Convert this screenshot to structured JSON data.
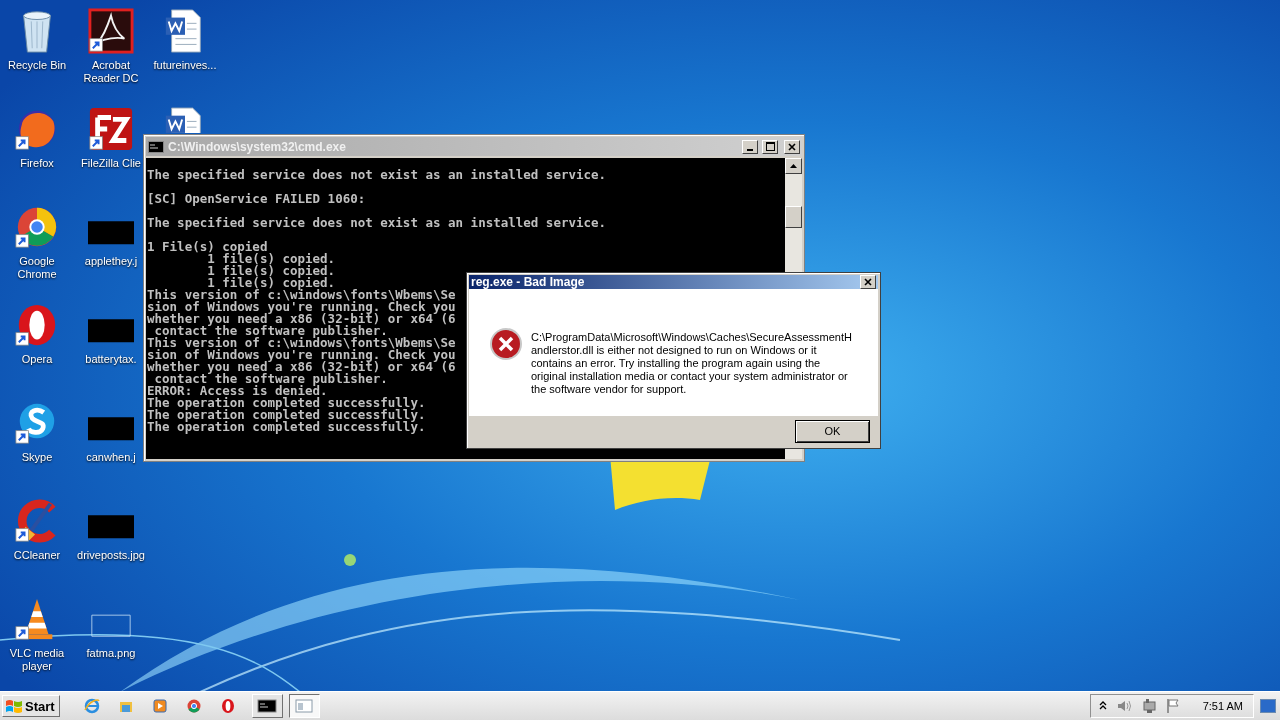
{
  "desktop": {
    "icons": [
      {
        "label": "Recycle Bin",
        "kind": "bin",
        "shortcut": false
      },
      {
        "label": "Firefox",
        "kind": "app",
        "shortcut": true
      },
      {
        "label": "Google Chrome",
        "kind": "app",
        "shortcut": true
      },
      {
        "label": "Opera",
        "kind": "app",
        "shortcut": true
      },
      {
        "label": "Skype",
        "kind": "app",
        "shortcut": true
      },
      {
        "label": "CCleaner",
        "kind": "app",
        "shortcut": true
      },
      {
        "label": "VLC media player",
        "kind": "app",
        "shortcut": true
      },
      {
        "label": "Acrobat Reader DC",
        "kind": "app",
        "shortcut": true
      },
      {
        "label": "FileZilla Clie",
        "kind": "app",
        "shortcut": true
      },
      {
        "label": "applethey.j",
        "shortcut": false
      },
      {
        "label": "batterytax.",
        "shortcut": false
      },
      {
        "label": "canwhen.j",
        "shortcut": false
      },
      {
        "label": "driveposts.jpg",
        "shortcut": false
      },
      {
        "label": "fatma.png",
        "kind": "blank-image",
        "shortcut": false
      },
      {
        "label": "futureinves...",
        "kind": "document",
        "shortcut": false
      },
      {
        "kind": "document"
      }
    ]
  },
  "console_window": {
    "title": "C:\\Windows\\system32\\cmd.exe",
    "active": false,
    "output": [
      [
        "The specified service does not exist as an installed service."
      ],
      [
        "[SC] OpenService FAILED 1060:"
      ],
      [
        "The specified service does not exist as an installed service."
      ],
      [
        "1 File(s) copied",
        "        1 file(s) copied.",
        "        1 file(s) copied.",
        "        1 file(s) copied.",
        "This version of c:\\windows\\fonts\\Wbems\\Se",
        "sion of Windows you're running. Check you",
        "whether you need a x86 (32-bit) or x64 (6",
        " contact the software publisher.",
        "This version of c:\\windows\\fonts\\Wbems\\Se",
        "sion of Windows you're running. Check you",
        "whether you need a x86 (32-bit) or x64 (6",
        " contact the software publisher.",
        "ERROR: Access is denied.",
        "The operation completed successfully.",
        "The operation completed successfully.",
        "The operation completed successfully."
      ]
    ]
  },
  "dialog": {
    "title": "reg.exe - Bad Image",
    "active": true,
    "message": "C:\\ProgramData\\Microsoft\\Windows\\Caches\\SecureAssessmentHandlerstor.dll is either not designed to run on Windows or it contains an error. Try installing the program again using the original installation media or contact your system administrator or the software vendor for support.",
    "buttons": [
      "OK"
    ]
  },
  "taskbar": {
    "start": "Start",
    "tasks": [
      {
        "selected": false
      },
      {
        "selected": true
      }
    ],
    "clock": "7:51 AM"
  }
}
